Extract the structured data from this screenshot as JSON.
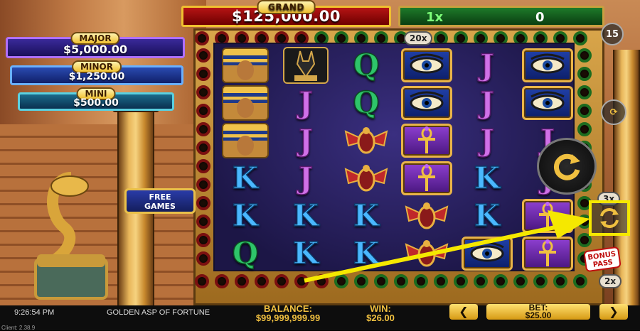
{
  "jackpots": {
    "grand": {
      "label": "GRAND",
      "value": "$125,000.00"
    },
    "major": {
      "label": "MAJOR",
      "value": "$5,000.00"
    },
    "minor": {
      "label": "MINOR",
      "value": "$1,250.00"
    },
    "mini": {
      "label": "MINI",
      "value": "$500.00"
    }
  },
  "multiplier_bar": {
    "multiplier": "1x",
    "value": "0"
  },
  "side_badges": {
    "top": "20x",
    "top_right": "15",
    "mid": "3x",
    "bottom": "2x"
  },
  "free_games": {
    "line1": "FREE",
    "line2": "GAMES"
  },
  "bonus_pass": {
    "line1": "BONUS",
    "line2": "PASS"
  },
  "reels": [
    [
      "pharaoh",
      "pharaoh",
      "pharaoh",
      "K",
      "K",
      "Q"
    ],
    [
      "anubis",
      "J",
      "J",
      "J",
      "K",
      "K"
    ],
    [
      "Q",
      "Q",
      "scarab",
      "scarab",
      "K",
      "K"
    ],
    [
      "eye",
      "eye",
      "ankh",
      "ankh",
      "scarab",
      "scarab"
    ],
    [
      "J",
      "J",
      "J",
      "K",
      "K",
      "eye"
    ],
    [
      "eye",
      "eye",
      "J",
      "J",
      "ankh",
      "ankh"
    ]
  ],
  "footer": {
    "time": "9:26:54 PM",
    "game_title": "GOLDEN ASP OF FORTUNE",
    "balance_label": "BALANCE:",
    "balance_value": "$99,999,999.99",
    "win_label": "WIN:",
    "win_value": "$26.00",
    "bet_label": "BET:",
    "bet_value": "$25.00",
    "prev": "❮",
    "next": "❯",
    "client": "Client: 2.38.9"
  },
  "colors": {
    "highlight": "#f5e800",
    "grand_bg": "#b51414",
    "mult_bg": "#1e7a2a"
  }
}
